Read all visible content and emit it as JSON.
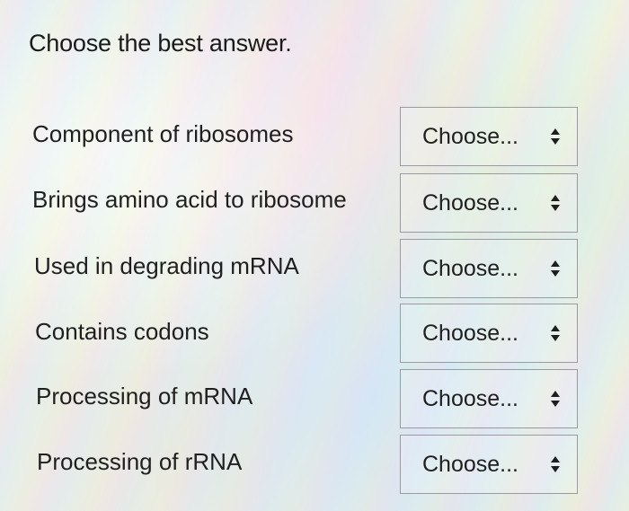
{
  "prompt": {
    "title": "Choose the best answer."
  },
  "rows": [
    {
      "label": "Component of ribosomes",
      "select_value": "Choose..."
    },
    {
      "label": "Brings amino acid to ribosome",
      "select_value": "Choose..."
    },
    {
      "label": "Used in degrading mRNA",
      "select_value": "Choose..."
    },
    {
      "label": "Contains codons",
      "select_value": "Choose..."
    },
    {
      "label": "Processing of mRNA",
      "select_value": "Choose..."
    },
    {
      "label": "Processing of rRNA",
      "select_value": "Choose..."
    }
  ],
  "icons": {
    "select_arrows": "up-down-arrows-icon"
  }
}
